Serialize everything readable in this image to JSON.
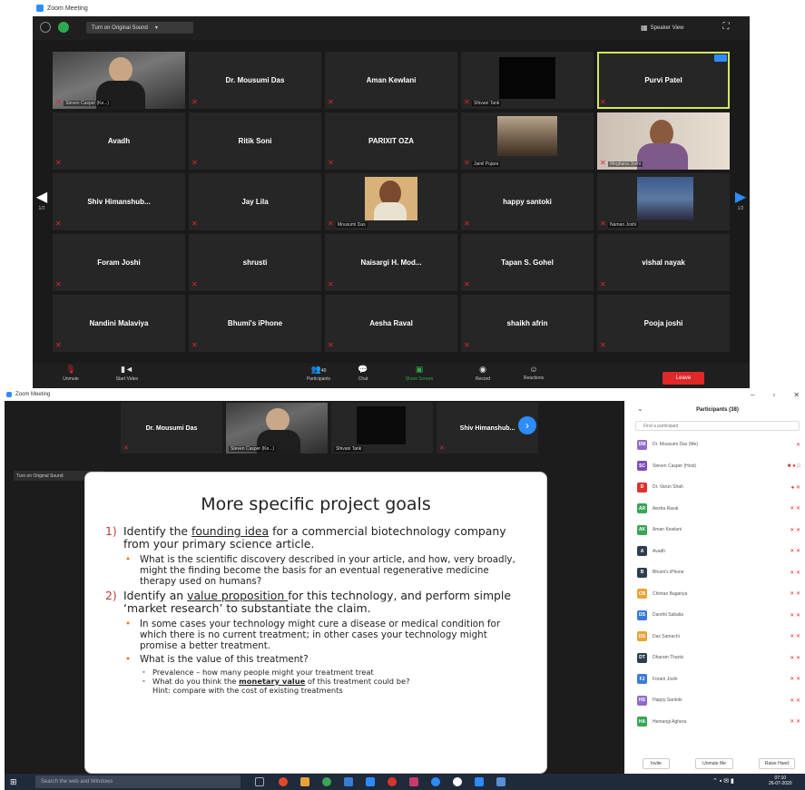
{
  "window_top": {
    "title": "Zoom Meeting",
    "original_sound_label": "Turn on Original Sound",
    "speaker_view_label": "Speaker View",
    "left_page": "1/2",
    "right_page": "1/2",
    "tiles": [
      {
        "name": "Steven Casper",
        "video": true,
        "caption": "Steven Casper (Ke...)"
      },
      {
        "name": "Dr. Mousumi Das"
      },
      {
        "name": "Aman Kewlani"
      },
      {
        "name": "Shivani Tank",
        "video": true,
        "caption": "Shivani Tank"
      },
      {
        "name": "Purvi Patel",
        "active": true
      },
      {
        "name": "Avadh"
      },
      {
        "name": "Ritik Soni"
      },
      {
        "name": "PARIXIT OZA"
      },
      {
        "name": "Jainil Pujara",
        "video": true,
        "caption": "Jainil Pujara"
      },
      {
        "name": "Meghana Joshi",
        "video": true,
        "caption": "Meghana Joshi"
      },
      {
        "name": "Shiv  Himanshub..."
      },
      {
        "name": "Jay Lila"
      },
      {
        "name": "Mousumi Das",
        "video": true,
        "caption": "Mousumi Das"
      },
      {
        "name": "happy santoki"
      },
      {
        "name": "Naman Joshi",
        "video": true,
        "caption": "Naman Joshi"
      },
      {
        "name": "Foram Joshi"
      },
      {
        "name": "shrusti"
      },
      {
        "name": "Naisargi  H. Mod..."
      },
      {
        "name": "Tapan S. Gohel"
      },
      {
        "name": "vishal nayak"
      },
      {
        "name": "Nandini Malaviya"
      },
      {
        "name": "Bhumi's iPhone"
      },
      {
        "name": "Aesha Raval"
      },
      {
        "name": "shaikh afrin"
      },
      {
        "name": "Pooja joshi"
      }
    ],
    "toolbar": {
      "unmute": "Unmute",
      "start_video": "Start Video",
      "participants": "Participants",
      "participants_count": "40",
      "chat": "Chat",
      "share_screen": "Share Screen",
      "record": "Record",
      "reactions": "Reactions",
      "leave": "Leave"
    }
  },
  "window_bottom": {
    "title": "Zoom Meeting",
    "original_sound_label": "Turn on Original Sound",
    "strip": [
      {
        "name": "Dr. Mousumi Das"
      },
      {
        "name": "Steven Casper (Ke...)",
        "video": true
      },
      {
        "name": "Shivani Tank",
        "video": true
      },
      {
        "name": "Shiv  Himanshub..."
      }
    ],
    "slide": {
      "title": "More specific project goals",
      "goal1": {
        "num": "1)",
        "pre": "Identify the ",
        "underlined": "founding idea",
        "post": " for a commercial biotechnology company from your primary science article.",
        "bullets": [
          "What is the scientific discovery described in your article, and how, very broadly, might the finding become the basis for an eventual regenerative medicine therapy used on humans?"
        ]
      },
      "goal2": {
        "num": "2)",
        "pre": "Identify an ",
        "underlined": "value proposition ",
        "post": "for this technology, and perform simple ‘market research’ to substantiate the claim.",
        "bullet1": "In some cases your technology might cure a disease or medical condition for which there is no current treatment; in other cases your technology might promise a better treatment.",
        "bullet2": "What is the value of this treatment?",
        "sub1": "Prevalence – how many people might your treatment treat",
        "sub2_pre": "What do you think the ",
        "sub2_bold": "monetary value",
        "sub2_post": " of this treatment could be?",
        "sub2_hint": "Hint: compare with the cost of existing treatments"
      }
    },
    "participants_panel": {
      "title": "Participants (38)",
      "search_placeholder": "Find a participant",
      "rows": [
        {
          "initials": "DM",
          "name": "Dr. Mousumi Das (Me)",
          "color": "#8e6cc8",
          "icons": "✕"
        },
        {
          "initials": "SC",
          "name": "Steven Casper (Host)",
          "color": "#7c4dbd",
          "icons": "■ ● □"
        },
        {
          "initials": "D",
          "name": "Dr. Varun Shah",
          "color": "#d9342b",
          "icons": "● ✕"
        },
        {
          "initials": "AR",
          "name": "Aesha Raval",
          "color": "#3aa457",
          "icons": "✕ ✕"
        },
        {
          "initials": "AK",
          "name": "Aman Kewlani",
          "color": "#3aa457",
          "icons": "✕ ✕"
        },
        {
          "initials": "A",
          "name": "Avadh",
          "color": "#2f3d4f",
          "icons": "✕ ✕"
        },
        {
          "initials": "B",
          "name": "Bhumi's iPhone",
          "color": "#2f3d4f",
          "icons": "✕ ✕"
        },
        {
          "initials": "CB",
          "name": "Chintan Bagariya",
          "color": "#e8a23a",
          "icons": "✕ ✕"
        },
        {
          "initials": "DS",
          "name": "Darshit Sabalia",
          "color": "#3a7bd5",
          "icons": "✕ ✕"
        },
        {
          "initials": "DS",
          "name": "Dax Samachi",
          "color": "#e8a23a",
          "icons": "✕ ✕"
        },
        {
          "initials": "DT",
          "name": "Dharam Thanki",
          "color": "#2f3d4f",
          "icons": "✕ ✕"
        },
        {
          "initials": "FJ",
          "name": "Foram Joshi",
          "color": "#3a7bd5",
          "icons": "✕ ✕"
        },
        {
          "initials": "HS",
          "name": "Happy Santoki",
          "color": "#8e6cc8",
          "icons": "✕ ✕"
        },
        {
          "initials": "HA",
          "name": "Hemangi Aghera",
          "color": "#3aa457",
          "icons": "✕ ✕"
        }
      ],
      "invite": "Invite",
      "unmute_me": "Unmute Me",
      "raise_hand": "Raise Hand"
    },
    "taskbar": {
      "search_placeholder": "Search the web and Windows",
      "time": "07:10",
      "date": "26-07-2020"
    }
  }
}
